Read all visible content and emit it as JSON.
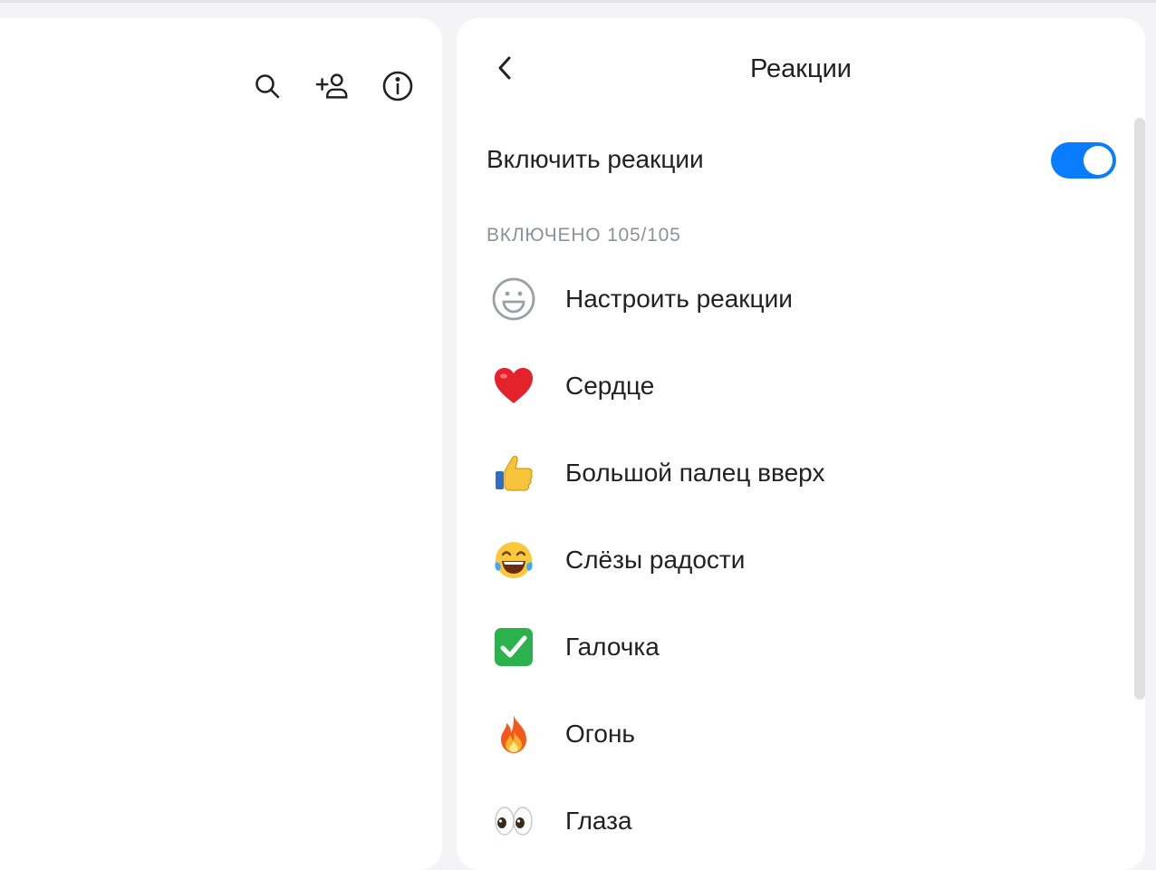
{
  "colors": {
    "accent": "#0a7cff",
    "muted_text": "#8a929c",
    "background": "#f4f4f6"
  },
  "left_panel": {
    "icons": [
      {
        "name": "search-icon"
      },
      {
        "name": "add-member-icon"
      },
      {
        "name": "info-icon"
      }
    ]
  },
  "reactions_panel": {
    "title": "Реакции",
    "toggle": {
      "label": "Включить реакции",
      "on": true
    },
    "section_header": "ВКЛЮЧЕНО 105/105",
    "items": [
      {
        "label": "Настроить реакции",
        "icon": "smiley-outline-icon"
      },
      {
        "label": "Сердце",
        "icon": "red-heart-emoji"
      },
      {
        "label": "Большой палец вверх",
        "icon": "thumbs-up-emoji"
      },
      {
        "label": "Слёзы радости",
        "icon": "tears-of-joy-emoji"
      },
      {
        "label": "Галочка",
        "icon": "check-mark-emoji"
      },
      {
        "label": "Огонь",
        "icon": "fire-emoji"
      },
      {
        "label": "Глаза",
        "icon": "eyes-emoji"
      }
    ]
  }
}
